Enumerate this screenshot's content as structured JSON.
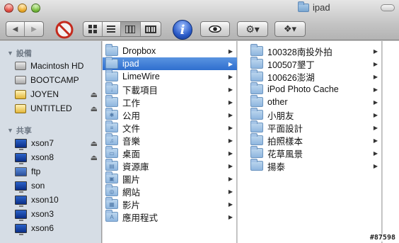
{
  "window": {
    "title": "ipad"
  },
  "toolbar": {
    "back_label": "◀",
    "forward_label": "▶",
    "view_icon_label": "▦",
    "view_list_label": "≡",
    "view_column_label": "▥",
    "view_coverflow_label": "▤",
    "info_label": "i",
    "quicklook_label": "◉",
    "action_label": "⚙▾",
    "dropbox_label": "❖▾"
  },
  "sidebar": {
    "devices_header": "設備",
    "devices": [
      {
        "label": "Macintosh HD",
        "icon": "hard-drive-icon",
        "eject": false
      },
      {
        "label": "BOOTCAMP",
        "icon": "hard-drive-icon",
        "eject": false
      },
      {
        "label": "JOYEN",
        "icon": "external-drive-icon",
        "eject": true
      },
      {
        "label": "UNTITLED",
        "icon": "external-drive-icon",
        "eject": true
      }
    ],
    "shared_header": "共享",
    "shared": [
      {
        "label": "xson7",
        "icon": "computer-icon",
        "eject": true
      },
      {
        "label": "xson8",
        "icon": "computer-icon",
        "eject": true
      },
      {
        "label": "ftp",
        "icon": "network-icon",
        "eject": false
      },
      {
        "label": "son",
        "icon": "computer-icon",
        "eject": false
      },
      {
        "label": "xson10",
        "icon": "computer-icon",
        "eject": false
      },
      {
        "label": "xson3",
        "icon": "computer-icon",
        "eject": false
      },
      {
        "label": "xson6",
        "icon": "computer-icon",
        "eject": false
      }
    ],
    "eject_glyph": "⏏"
  },
  "column1": {
    "items": [
      {
        "label": "Dropbox",
        "glyph": "",
        "selected": false
      },
      {
        "label": "ipad",
        "glyph": "",
        "selected": true
      },
      {
        "label": "LimeWire",
        "glyph": "",
        "selected": false
      },
      {
        "label": "下載項目",
        "glyph": "↓",
        "selected": false
      },
      {
        "label": "工作",
        "glyph": "",
        "selected": false
      },
      {
        "label": "公用",
        "glyph": "✱",
        "selected": false
      },
      {
        "label": "文件",
        "glyph": "≡",
        "selected": false
      },
      {
        "label": "音樂",
        "glyph": "♫",
        "selected": false
      },
      {
        "label": "桌面",
        "glyph": "▭",
        "selected": false
      },
      {
        "label": "資源庫",
        "glyph": "▤",
        "selected": false
      },
      {
        "label": "圖片",
        "glyph": "▣",
        "selected": false
      },
      {
        "label": "網站",
        "glyph": "◎",
        "selected": false
      },
      {
        "label": "影片",
        "glyph": "▦",
        "selected": false
      },
      {
        "label": "應用程式",
        "glyph": "A",
        "selected": false
      }
    ]
  },
  "column2": {
    "items": [
      {
        "label": "100328南投外拍"
      },
      {
        "label": "100507墾丁"
      },
      {
        "label": "100626澎湖"
      },
      {
        "label": "iPod Photo Cache"
      },
      {
        "label": "other"
      },
      {
        "label": "小朋友"
      },
      {
        "label": "平面設計"
      },
      {
        "label": "拍照樣本"
      },
      {
        "label": "花草風景"
      },
      {
        "label": "揚泰"
      }
    ]
  },
  "watermark": "#87598",
  "colors": {
    "selection": "#3a78d4",
    "sidebar_bg": "#d6dde5",
    "info_button": "#2b5bc8"
  }
}
